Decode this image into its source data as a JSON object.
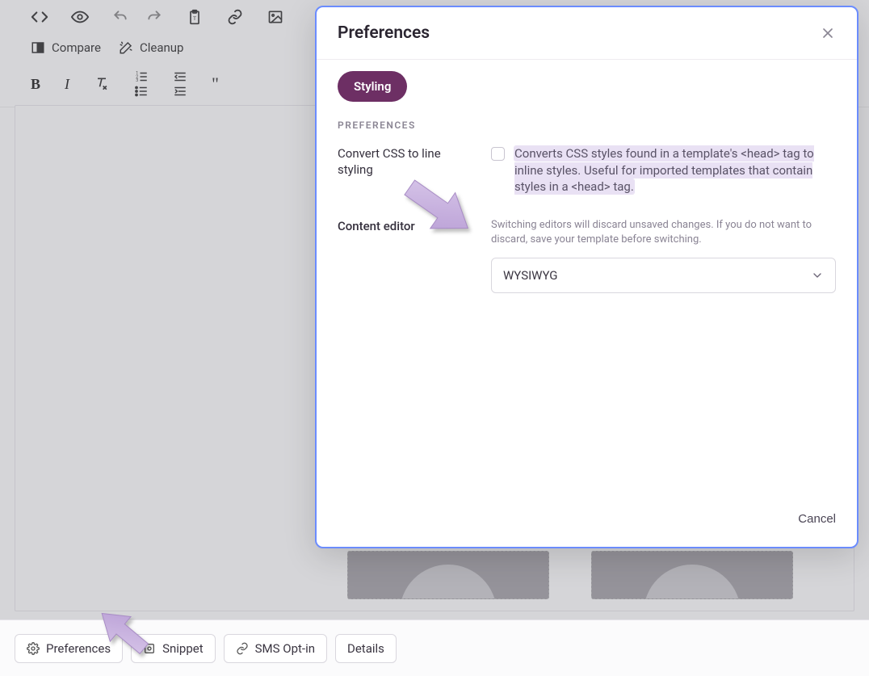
{
  "toolbar2": {
    "compare": "Compare",
    "cleanup": "Cleanup"
  },
  "modal": {
    "title": "Preferences",
    "tab_styling": "Styling",
    "section_label": "PREFERENCES",
    "css_label": "Convert CSS to line styling",
    "css_help": "Converts CSS styles found in a template's <head> tag to inline styles. Useful for imported templates that contain styles in a <head> tag.",
    "editor_label": "Content editor",
    "editor_note": "Switching editors will discard unsaved changes. If you do not want to discard, save your template before switching.",
    "editor_value": "WYSIWYG",
    "cancel": "Cancel"
  },
  "bottom": {
    "preferences": "Preferences",
    "snippet": "Snippet",
    "sms": "SMS Opt-in",
    "details": "Details"
  }
}
